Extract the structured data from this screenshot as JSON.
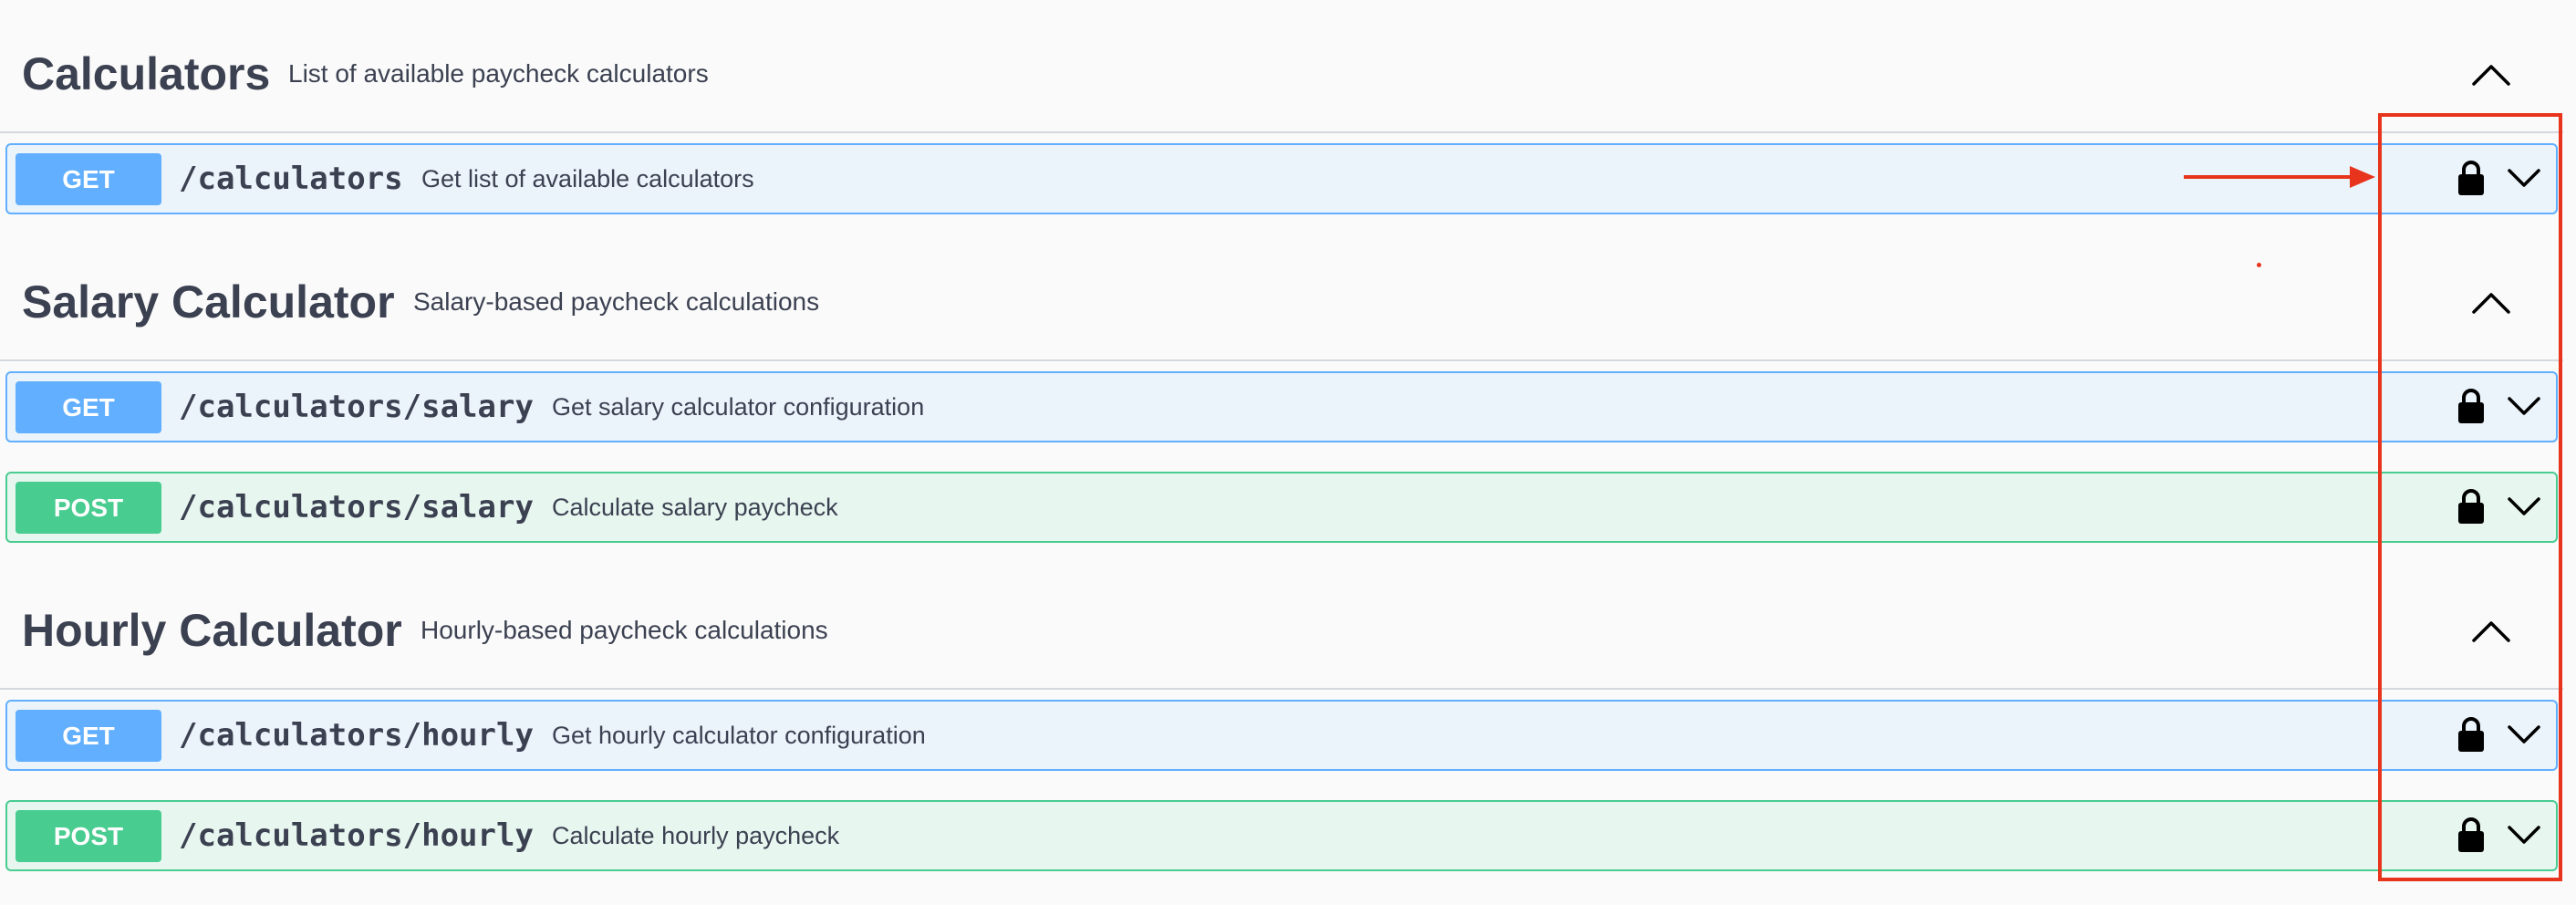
{
  "sections": [
    {
      "title": "Calculators",
      "description": "List of available paycheck calculators",
      "operations": [
        {
          "method": "GET",
          "path": "/calculators",
          "summary": "Get list of available calculators"
        }
      ]
    },
    {
      "title": "Salary Calculator",
      "description": "Salary-based paycheck calculations",
      "operations": [
        {
          "method": "GET",
          "path": "/calculators/salary",
          "summary": "Get salary calculator configuration"
        },
        {
          "method": "POST",
          "path": "/calculators/salary",
          "summary": "Calculate salary paycheck"
        }
      ]
    },
    {
      "title": "Hourly Calculator",
      "description": "Hourly-based paycheck calculations",
      "operations": [
        {
          "method": "GET",
          "path": "/calculators/hourly",
          "summary": "Get hourly calculator configuration"
        },
        {
          "method": "POST",
          "path": "/calculators/hourly",
          "summary": "Calculate hourly paycheck"
        }
      ]
    }
  ],
  "icons": {
    "tag_toggle": "chevron-up-icon",
    "operation_lock": "lock-icon",
    "operation_expand": "chevron-down-icon"
  },
  "colors": {
    "get": "#61affe",
    "post": "#49cc90",
    "get_bg": "#ebf3fb",
    "post_bg": "#e8f6f0",
    "annotation": "#e8341c"
  }
}
